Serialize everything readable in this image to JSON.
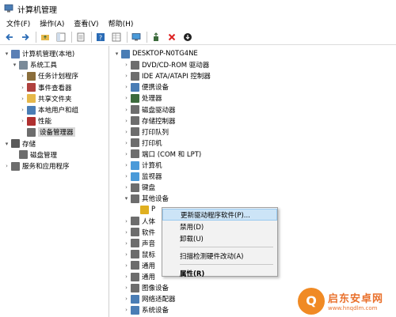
{
  "window": {
    "title": "计算机管理"
  },
  "menu": [
    "文件(F)",
    "操作(A)",
    "查看(V)",
    "帮助(H)"
  ],
  "left_tree": [
    {
      "label": "计算机管理(本地)",
      "level": 0,
      "expander": "▾",
      "icon": "computer-mgmt-icon",
      "color": "#5a7fb5"
    },
    {
      "label": "系统工具",
      "level": 1,
      "expander": "▾",
      "icon": "tools-icon",
      "color": "#7a8a99"
    },
    {
      "label": "任务计划程序",
      "level": 2,
      "expander": "›",
      "icon": "clock-icon",
      "color": "#8a6d3b"
    },
    {
      "label": "事件查看器",
      "level": 2,
      "expander": "›",
      "icon": "event-viewer-icon",
      "color": "#b0413e"
    },
    {
      "label": "共享文件夹",
      "level": 2,
      "expander": "›",
      "icon": "shared-folder-icon",
      "color": "#e6b84a"
    },
    {
      "label": "本地用户和组",
      "level": 2,
      "expander": "›",
      "icon": "users-icon",
      "color": "#4a7db5"
    },
    {
      "label": "性能",
      "level": 2,
      "expander": "›",
      "icon": "performance-icon",
      "color": "#b03030"
    },
    {
      "label": "设备管理器",
      "level": 2,
      "expander": "",
      "icon": "device-manager-icon",
      "color": "#6d6d6d",
      "selected": true
    },
    {
      "label": "存储",
      "level": 0,
      "expander": "▾",
      "icon": "storage-icon",
      "color": "#5a5a5a"
    },
    {
      "label": "磁盘管理",
      "level": 1,
      "expander": "",
      "icon": "disk-icon",
      "color": "#6d6d6d"
    },
    {
      "label": "服务和应用程序",
      "level": 0,
      "expander": "›",
      "icon": "services-icon",
      "color": "#6d6d6d"
    }
  ],
  "device_tree": [
    {
      "label": "DESKTOP-N0TG4NE",
      "level": 0,
      "expander": "▾",
      "icon": "computer-icon",
      "color": "#4a7db5"
    },
    {
      "label": "DVD/CD-ROM 驱动器",
      "level": 1,
      "expander": "›",
      "icon": "dvd-icon",
      "color": "#6d6d6d"
    },
    {
      "label": "IDE ATA/ATAPI 控制器",
      "level": 1,
      "expander": "›",
      "icon": "ide-icon",
      "color": "#6d6d6d"
    },
    {
      "label": "便携设备",
      "level": 1,
      "expander": "›",
      "icon": "portable-icon",
      "color": "#4a7db5"
    },
    {
      "label": "处理器",
      "level": 1,
      "expander": "›",
      "icon": "cpu-icon",
      "color": "#3d6b3d"
    },
    {
      "label": "磁盘驱动器",
      "level": 1,
      "expander": "›",
      "icon": "disk-drive-icon",
      "color": "#6d6d6d"
    },
    {
      "label": "存储控制器",
      "level": 1,
      "expander": "›",
      "icon": "storage-controller-icon",
      "color": "#6d6d6d"
    },
    {
      "label": "打印队列",
      "level": 1,
      "expander": "›",
      "icon": "print-queue-icon",
      "color": "#6d6d6d"
    },
    {
      "label": "打印机",
      "level": 1,
      "expander": "›",
      "icon": "printer-icon",
      "color": "#6d6d6d"
    },
    {
      "label": "端口 (COM 和 LPT)",
      "level": 1,
      "expander": "›",
      "icon": "port-icon",
      "color": "#6d6d6d"
    },
    {
      "label": "计算机",
      "level": 1,
      "expander": "›",
      "icon": "computer-icon",
      "color": "#4a9ad9"
    },
    {
      "label": "监视器",
      "level": 1,
      "expander": "›",
      "icon": "monitor-icon",
      "color": "#4a9ad9"
    },
    {
      "label": "键盘",
      "level": 1,
      "expander": "›",
      "icon": "keyboard-icon",
      "color": "#6d6d6d"
    },
    {
      "label": "其他设备",
      "level": 1,
      "expander": "▾",
      "icon": "other-devices-icon",
      "color": "#6d6d6d"
    },
    {
      "label": "P",
      "level": 2,
      "expander": "",
      "icon": "unknown-device-warning-icon",
      "color": "#e0b020"
    },
    {
      "label": "人体",
      "level": 1,
      "expander": "›",
      "icon": "hid-icon",
      "color": "#6d6d6d"
    },
    {
      "label": "软件",
      "level": 1,
      "expander": "›",
      "icon": "software-device-icon",
      "color": "#6d6d6d"
    },
    {
      "label": "声音",
      "level": 1,
      "expander": "›",
      "icon": "sound-icon",
      "color": "#6d6d6d"
    },
    {
      "label": "鼠标",
      "level": 1,
      "expander": "›",
      "icon": "mouse-icon",
      "color": "#6d6d6d"
    },
    {
      "label": "通用",
      "level": 1,
      "expander": "›",
      "icon": "usb-icon",
      "color": "#6d6d6d"
    },
    {
      "label": "通用",
      "level": 1,
      "expander": "›",
      "icon": "usb-icon",
      "color": "#6d6d6d"
    },
    {
      "label": "图像设备",
      "level": 1,
      "expander": "›",
      "icon": "imaging-icon",
      "color": "#6d6d6d"
    },
    {
      "label": "网络适配器",
      "level": 1,
      "expander": "›",
      "icon": "network-adapter-icon",
      "color": "#4a7db5"
    },
    {
      "label": "系统设备",
      "level": 1,
      "expander": "›",
      "icon": "system-device-icon",
      "color": "#4a7db5"
    }
  ],
  "context_menu": [
    {
      "label": "更新驱动程序软件(P)...",
      "hover": true
    },
    {
      "label": "禁用(D)"
    },
    {
      "label": "卸载(U)"
    },
    {
      "separator": true
    },
    {
      "label": "扫描检测硬件改动(A)"
    },
    {
      "separator": true
    },
    {
      "label": "属性(R)",
      "bold": true
    }
  ],
  "watermark": {
    "name": "启东安卓网",
    "url": "www.hnqdlm.com",
    "logo_letter": "Q"
  }
}
